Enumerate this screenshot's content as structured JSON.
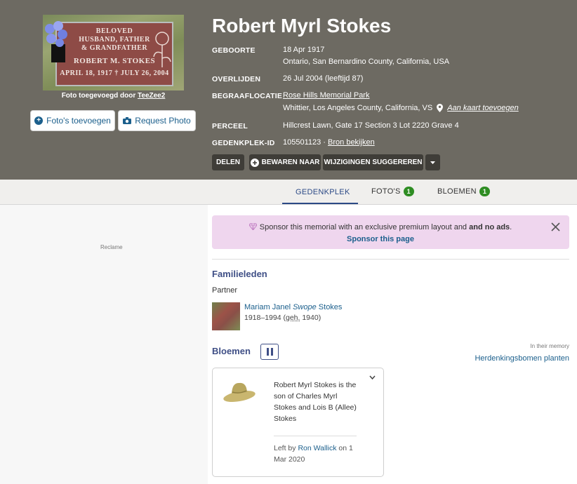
{
  "memorial": {
    "name": "Robert Myrl Stokes",
    "photo_caption_prefix": "Foto toegevoegd door",
    "photo_caption_user": "TeeZee2",
    "stone_lines": [
      "BELOVED",
      "HUSBAND, FATHER",
      "& GRANDFATHER",
      "ROBERT M. STOKES",
      "APRIL 18, 1917 † JULY 26, 2004"
    ]
  },
  "photo_buttons": {
    "add_label": "Foto's toevoegen",
    "request_label": "Request Photo"
  },
  "facts": {
    "birth_label": "GEBOORTE",
    "birth_date": "18 Apr 1917",
    "birth_place": "Ontario, San Bernardino County, California, USA",
    "death_label": "OVERLIJDEN",
    "death_value": "26 Jul 2004 (leeftijd 87)",
    "burial_label": "BEGRAAFLOCATIE",
    "burial_cemetery": "Rose Hills Memorial Park",
    "burial_place": "Whittier, Los Angeles County, California, VS",
    "add_map_label": "Aan kaart toevoegen",
    "plot_label": "PERCEEL",
    "plot_value": "Hillcrest Lawn, Gate 17 Section 3 Lot 2220 Grave 4",
    "id_label": "GEDENKPLEK-ID",
    "id_value": "105501123 ·",
    "id_source_link": "Bron bekijken"
  },
  "actions": {
    "share": "DELEN",
    "save": "BEWAREN NAAR",
    "suggest": "WIJZIGINGEN SUGGEREREN"
  },
  "tabs": {
    "memorial": "GEDENKPLEK",
    "photos": "FOTO'S",
    "photos_count": "1",
    "flowers": "BLOEMEN",
    "flowers_count": "1"
  },
  "ad": {
    "label": "Reclame"
  },
  "sponsor": {
    "text_prefix": "Sponsor this memorial with an exclusive premium layout",
    "text_and": "and no ads",
    "link": "Sponsor this page"
  },
  "family": {
    "heading": "Familieleden",
    "partner_label": "Partner",
    "partner_first": "Mariam Janel",
    "partner_maiden": "Swope",
    "partner_last": "Stokes",
    "partner_years": "1918–1994 (",
    "partner_geh": "geh.",
    "partner_married": " 1940)"
  },
  "flowers": {
    "heading": "Bloemen",
    "in_memory_label": "In their memory",
    "plant_trees_link": "Herdenkingsbomen planten",
    "card": {
      "message": "Robert Myrl Stokes is the son of Charles Myrl Stokes and Lois B (Allee) Stokes",
      "left_by_prefix": "Left by",
      "left_by_user": "Ron Wallick",
      "left_by_suffix": "on 1 Mar 2020"
    }
  },
  "colors": {
    "header_bg": "#6d6a62",
    "link_blue": "#1b5f8c",
    "section_heading": "#3f4f86",
    "badge_green": "#2f8d23",
    "sponsor_bg": "#efd6ee"
  }
}
